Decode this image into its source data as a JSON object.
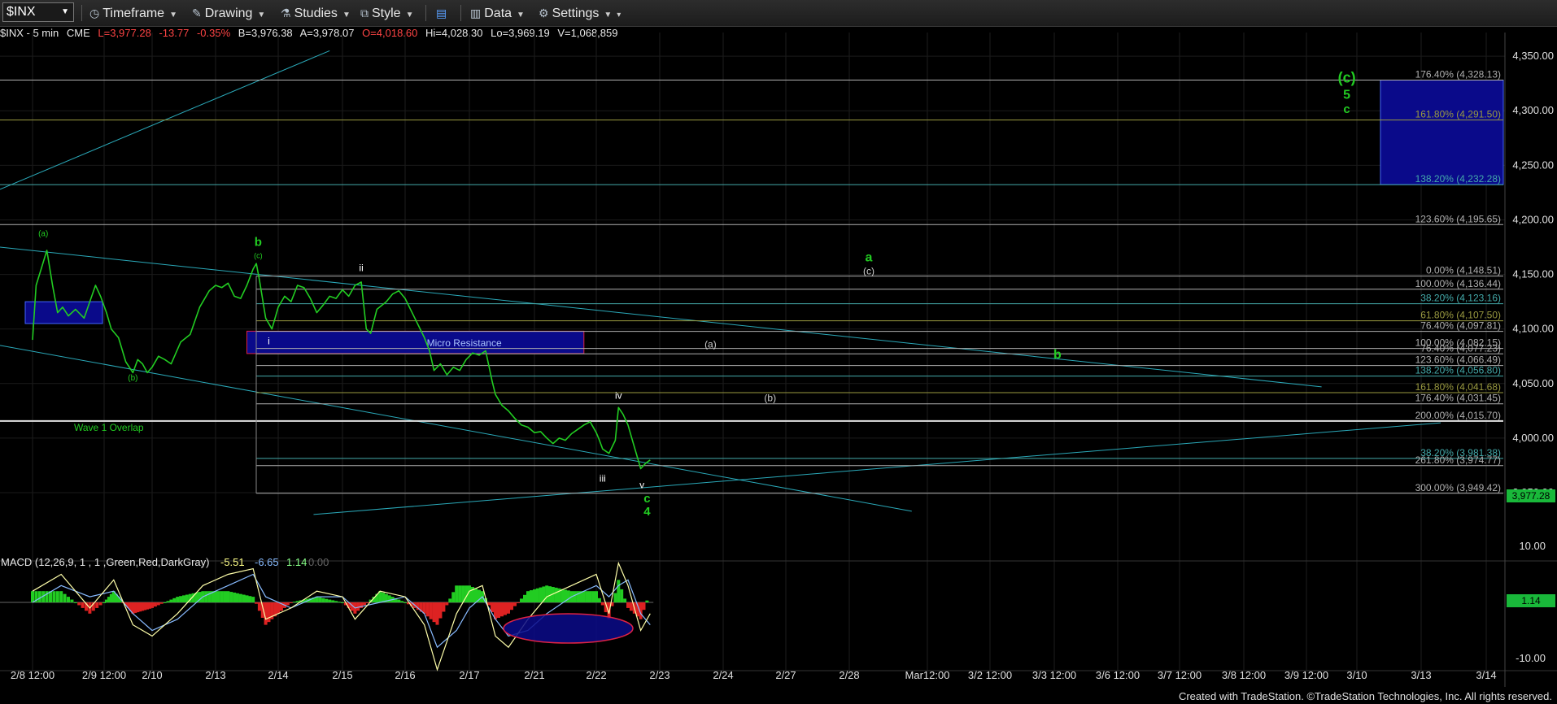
{
  "toolbar": {
    "symbol": "$INX",
    "timeframe": "Timeframe",
    "drawing": "Drawing",
    "studies": "Studies",
    "style": "Style",
    "data": "Data",
    "settings": "Settings"
  },
  "infobar": {
    "symbol": "$INX - 5 min",
    "exchange": "CME",
    "last": "L=3,977.28",
    "change": "-13.77",
    "change_pct": "-0.35%",
    "bid": "B=3,976.38",
    "ask": "A=3,978.07",
    "open": "O=4,018.60",
    "high": "Hi=4,028.30",
    "low": "Lo=3,969.19",
    "volume": "V=1,068,859",
    "colors": {
      "neutral": "#e8e8e8",
      "down": "#ff4444"
    }
  },
  "price_badge": "3,977.28",
  "macd_badge": "1.14",
  "macd_header": {
    "title": "MACD (12,26,9, 1 , 1 ,Green,Red,DarkGray)",
    "macd": "-5.51",
    "avg": "-6.65",
    "diff": "1.14",
    "zero": "0.00"
  },
  "footer": "Created with TradeStation. ©TradeStation Technologies, Inc. All rights reserved.",
  "chart_data": {
    "type": "line",
    "price_axis": {
      "ylim": [
        3915,
        4365
      ],
      "ticks": [
        "4,350.00",
        "4,300.00",
        "4,250.00",
        "4,200.00",
        "4,150.00",
        "4,100.00",
        "4,050.00",
        "4,000.00",
        "3,950.00"
      ],
      "values": [
        4350,
        4300,
        4250,
        4200,
        4150,
        4100,
        4050,
        4000,
        3950
      ]
    },
    "macd_axis": {
      "ticks": [
        "10.00",
        "-10.00"
      ],
      "values": [
        10,
        -10
      ]
    },
    "date_labels": [
      "2/8 12:00",
      "2/9 12:00",
      "2/10",
      "2/13",
      "2/14",
      "2/15",
      "2/16",
      "2/17",
      "2/21",
      "2/22",
      "2/23",
      "2/24",
      "2/27",
      "2/28",
      "Mar12:00",
      "3/2 12:00",
      "3/3 12:00",
      "3/6 12:00",
      "3/7 12:00",
      "3/8 12:00",
      "3/9 12:00",
      "3/10",
      "3/13",
      "3/14"
    ],
    "date_pos": [
      0,
      1,
      2,
      3,
      4,
      5,
      6,
      7,
      8,
      9,
      10,
      11,
      12,
      13,
      14,
      15,
      16,
      17,
      18,
      19,
      20,
      21,
      22,
      23
    ],
    "price_series": {
      "name": "$INX",
      "color": "#22cc22",
      "points": [
        [
          0,
          4090
        ],
        [
          0.05,
          4140
        ],
        [
          0.12,
          4155
        ],
        [
          0.2,
          4172
        ],
        [
          0.28,
          4140
        ],
        [
          0.35,
          4115
        ],
        [
          0.42,
          4120
        ],
        [
          0.5,
          4112
        ],
        [
          0.6,
          4118
        ],
        [
          0.72,
          4110
        ],
        [
          0.8,
          4125
        ],
        [
          0.88,
          4140
        ],
        [
          0.95,
          4130
        ],
        [
          1.05,
          4115
        ],
        [
          1.15,
          4100
        ],
        [
          1.3,
          4092
        ],
        [
          1.45,
          4070
        ],
        [
          1.6,
          4060
        ],
        [
          1.7,
          4072
        ],
        [
          1.8,
          4068
        ],
        [
          1.9,
          4060
        ],
        [
          2.0,
          4065
        ],
        [
          2.1,
          4075
        ],
        [
          2.2,
          4072
        ],
        [
          2.3,
          4068
        ],
        [
          2.45,
          4088
        ],
        [
          2.6,
          4095
        ],
        [
          2.75,
          4120
        ],
        [
          2.9,
          4135
        ],
        [
          3.0,
          4140
        ],
        [
          3.1,
          4138
        ],
        [
          3.2,
          4142
        ],
        [
          3.3,
          4130
        ],
        [
          3.4,
          4128
        ],
        [
          3.5,
          4140
        ],
        [
          3.6,
          4155
        ],
        [
          3.65,
          4160
        ],
        [
          3.7,
          4145
        ],
        [
          3.8,
          4110
        ],
        [
          3.9,
          4100
        ],
        [
          4.0,
          4120
        ],
        [
          4.1,
          4130
        ],
        [
          4.2,
          4125
        ],
        [
          4.3,
          4140
        ],
        [
          4.4,
          4138
        ],
        [
          4.5,
          4128
        ],
        [
          4.6,
          4115
        ],
        [
          4.7,
          4122
        ],
        [
          4.8,
          4130
        ],
        [
          4.9,
          4128
        ],
        [
          5.0,
          4136
        ],
        [
          5.1,
          4130
        ],
        [
          5.2,
          4140
        ],
        [
          5.3,
          4143
        ],
        [
          5.38,
          4100
        ],
        [
          5.45,
          4096
        ],
        [
          5.55,
          4118
        ],
        [
          5.7,
          4125
        ],
        [
          5.8,
          4132
        ],
        [
          5.9,
          4135
        ],
        [
          6.0,
          4128
        ],
        [
          6.15,
          4110
        ],
        [
          6.25,
          4098
        ],
        [
          6.3,
          4092
        ],
        [
          6.38,
          4080
        ],
        [
          6.45,
          4062
        ],
        [
          6.55,
          4068
        ],
        [
          6.65,
          4058
        ],
        [
          6.75,
          4065
        ],
        [
          6.85,
          4062
        ],
        [
          6.95,
          4072
        ],
        [
          7.05,
          4078
        ],
        [
          7.15,
          4076
        ],
        [
          7.25,
          4080
        ],
        [
          7.35,
          4052
        ],
        [
          7.4,
          4040
        ],
        [
          7.5,
          4030
        ],
        [
          7.6,
          4025
        ],
        [
          7.7,
          4018
        ],
        [
          7.8,
          4012
        ],
        [
          7.9,
          4010
        ],
        [
          8.0,
          4005
        ],
        [
          8.1,
          4006
        ],
        [
          8.2,
          4000
        ],
        [
          8.3,
          3995
        ],
        [
          8.4,
          4000
        ],
        [
          8.5,
          3998
        ],
        [
          8.6,
          4004
        ],
        [
          8.7,
          4008
        ],
        [
          8.8,
          4012
        ],
        [
          8.9,
          4015
        ],
        [
          9.0,
          4005
        ],
        [
          9.05,
          3998
        ],
        [
          9.1,
          3990
        ],
        [
          9.2,
          3986
        ],
        [
          9.3,
          3998
        ],
        [
          9.35,
          4028
        ],
        [
          9.42,
          4022
        ],
        [
          9.5,
          4012
        ],
        [
          9.58,
          3996
        ],
        [
          9.65,
          3982
        ],
        [
          9.7,
          3972
        ],
        [
          9.78,
          3977
        ],
        [
          9.85,
          3980
        ]
      ]
    },
    "macd_series": [
      {
        "name": "MACD",
        "color": "#ffffaa",
        "points": [
          [
            0,
            2
          ],
          [
            0.4,
            5
          ],
          [
            0.8,
            -1
          ],
          [
            1.2,
            4
          ],
          [
            1.6,
            -4
          ],
          [
            2.0,
            -6
          ],
          [
            2.4,
            -2
          ],
          [
            2.8,
            3
          ],
          [
            3.2,
            5
          ],
          [
            3.6,
            6
          ],
          [
            3.8,
            -3
          ],
          [
            4.2,
            -1
          ],
          [
            4.6,
            2
          ],
          [
            5.0,
            1
          ],
          [
            5.2,
            -3
          ],
          [
            5.6,
            2
          ],
          [
            6.0,
            1
          ],
          [
            6.3,
            -4
          ],
          [
            6.5,
            -12
          ],
          [
            6.8,
            -2
          ],
          [
            7.0,
            2
          ],
          [
            7.2,
            3
          ],
          [
            7.4,
            -6
          ],
          [
            7.6,
            -8
          ],
          [
            7.9,
            -3
          ],
          [
            8.2,
            1
          ],
          [
            8.6,
            3
          ],
          [
            9.0,
            5
          ],
          [
            9.2,
            -2
          ],
          [
            9.35,
            7
          ],
          [
            9.5,
            3
          ],
          [
            9.7,
            -5
          ],
          [
            9.85,
            -2
          ]
        ]
      },
      {
        "name": "MACDAvg",
        "color": "#88bbff",
        "points": [
          [
            0,
            0
          ],
          [
            0.4,
            3
          ],
          [
            0.8,
            1
          ],
          [
            1.2,
            2
          ],
          [
            1.6,
            -2
          ],
          [
            2.0,
            -5
          ],
          [
            2.4,
            -3
          ],
          [
            2.8,
            1
          ],
          [
            3.2,
            3
          ],
          [
            3.6,
            5
          ],
          [
            3.8,
            1
          ],
          [
            4.2,
            -1
          ],
          [
            4.6,
            1
          ],
          [
            5.0,
            1
          ],
          [
            5.2,
            -1
          ],
          [
            5.6,
            0
          ],
          [
            6.0,
            1
          ],
          [
            6.3,
            -2
          ],
          [
            6.5,
            -8
          ],
          [
            6.8,
            -5
          ],
          [
            7.0,
            -1
          ],
          [
            7.2,
            1
          ],
          [
            7.4,
            -3
          ],
          [
            7.6,
            -6
          ],
          [
            7.9,
            -5
          ],
          [
            8.2,
            -2
          ],
          [
            8.6,
            1
          ],
          [
            9.0,
            3
          ],
          [
            9.2,
            1
          ],
          [
            9.35,
            3
          ],
          [
            9.5,
            4
          ],
          [
            9.7,
            -2
          ],
          [
            9.85,
            -4
          ]
        ]
      }
    ],
    "fib_levels": [
      {
        "label": "176.40% (4,328.13)",
        "value": 4328.13,
        "color": "#b0b0b0"
      },
      {
        "label": "161.80% (4,291.50)",
        "value": 4291.5,
        "color": "#9a9a40"
      },
      {
        "label": "138.20% (4,232.28)",
        "value": 4232.28,
        "color": "#44aaaa"
      },
      {
        "label": "123.60% (4,195.65)",
        "value": 4195.65,
        "color": "#b0b0b0"
      },
      {
        "label": "0.00% (4,148.51)",
        "value": 4148.51,
        "color": "#b0b0b0"
      },
      {
        "label": "100.00% (4,136.44)",
        "value": 4136.44,
        "color": "#b0b0b0"
      },
      {
        "label": "38.20% (4,123.16)",
        "value": 4123.16,
        "color": "#44aaaa"
      },
      {
        "label": "61.80% (4,107.50)",
        "value": 4107.5,
        "color": "#9a9a40"
      },
      {
        "label": "76.40% (4,097.81)",
        "value": 4097.81,
        "color": "#b0b0b0"
      },
      {
        "label": "100.00% (4,082.15)",
        "value": 4082.15,
        "color": "#b0b0b0"
      },
      {
        "label": "76.40% (4,077.23)",
        "value": 4077.23,
        "color": "#b0b0b0"
      },
      {
        "label": "123.60% (4,066.49)",
        "value": 4066.49,
        "color": "#b0b0b0"
      },
      {
        "label": "138.20% (4,056.80)",
        "value": 4056.8,
        "color": "#44aaaa"
      },
      {
        "label": "161.80% (4,041.68)",
        "value": 4041.68,
        "color": "#9a9a40"
      },
      {
        "label": "176.40% (4,031.45)",
        "value": 4031.45,
        "color": "#b0b0b0"
      },
      {
        "label": "200.00% (4,015.70)",
        "value": 4015.7,
        "color": "#b0b0b0"
      },
      {
        "label": "38.20% (3,981.38)",
        "value": 3981.38,
        "color": "#44aaaa"
      },
      {
        "label": "261.80% (3,974.77)",
        "value": 3974.77,
        "color": "#b0b0b0"
      },
      {
        "label": "300.00% (3,949.42)",
        "value": 3949.42,
        "color": "#b0b0b0"
      }
    ],
    "annotations": {
      "micro_resistance": "Micro Resistance",
      "wave1_overlap": "Wave 1 Overlap",
      "wave_labels": [
        {
          "text": "(a)",
          "x": 0.15,
          "y": 4185,
          "color": "#22cc22",
          "size": 10
        },
        {
          "text": "(b)",
          "x": 1.6,
          "y": 4053,
          "color": "#22cc22",
          "size": 10
        },
        {
          "text": "b",
          "x": 3.68,
          "y": 4176,
          "color": "#22cc22",
          "size": 15
        },
        {
          "text": "(c)",
          "x": 3.68,
          "y": 4165,
          "color": "#22cc22",
          "size": 9
        },
        {
          "text": "i",
          "x": 3.85,
          "y": 4086,
          "color": "#ffffff",
          "size": 12
        },
        {
          "text": "ii",
          "x": 5.3,
          "y": 4153,
          "color": "#ffffff",
          "size": 12
        },
        {
          "text": "iii",
          "x": 9.1,
          "y": 3960,
          "color": "#ffffff",
          "size": 12
        },
        {
          "text": "iv",
          "x": 9.35,
          "y": 4036,
          "color": "#ffffff",
          "size": 12
        },
        {
          "text": "v",
          "x": 9.72,
          "y": 3954,
          "color": "#ffffff",
          "size": 12
        },
        {
          "text": "c",
          "x": 9.8,
          "y": 3941,
          "color": "#22cc22",
          "size": 15
        },
        {
          "text": "4",
          "x": 9.8,
          "y": 3929,
          "color": "#22cc22",
          "size": 15
        },
        {
          "text": "a",
          "x": 13.25,
          "y": 4162,
          "color": "#22cc22",
          "size": 16
        },
        {
          "text": "(c)",
          "x": 13.25,
          "y": 4150,
          "color": "#cccccc",
          "size": 12
        },
        {
          "text": "(a)",
          "x": 10.8,
          "y": 4083,
          "color": "#cccccc",
          "size": 12
        },
        {
          "text": "(b)",
          "x": 11.75,
          "y": 4034,
          "color": "#cccccc",
          "size": 12
        },
        {
          "text": "b",
          "x": 16.05,
          "y": 4073,
          "color": "#22cc22",
          "size": 16
        },
        {
          "text": "(c)",
          "x": 20.8,
          "y": 4326,
          "color": "#22cc22",
          "size": 18
        },
        {
          "text": "5",
          "x": 20.8,
          "y": 4311,
          "color": "#22cc22",
          "size": 16
        },
        {
          "text": "c",
          "x": 20.8,
          "y": 4298,
          "color": "#22cc22",
          "size": 15
        }
      ]
    }
  }
}
